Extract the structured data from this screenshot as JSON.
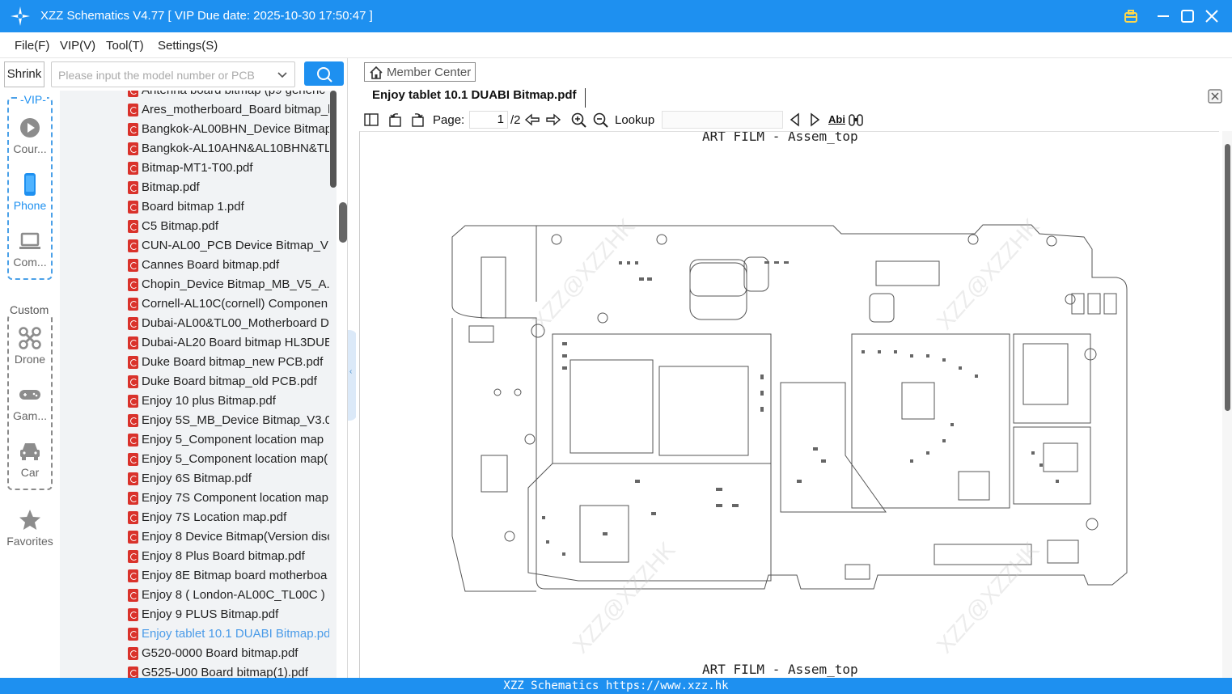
{
  "window": {
    "title": "XZZ Schematics V4.77 [ VIP Due date: 2025-10-30 17:50:47 ]",
    "accent": "#1e90f0"
  },
  "menu": [
    "File(F)",
    "VIP(V)",
    "Tool(T)",
    "Settings(S)"
  ],
  "left": {
    "shrink_label": "Shrink",
    "search_placeholder": "Please input the model number or PCB",
    "vip_label": "-VIP-",
    "custom_label": "Custom",
    "categories": [
      {
        "label": "Cour...",
        "icon": "play-icon"
      },
      {
        "label": "Phone",
        "icon": "phone-icon",
        "active": true
      },
      {
        "label": "Com...",
        "icon": "laptop-icon"
      },
      {
        "label": "Drone",
        "icon": "drone-icon"
      },
      {
        "label": "Gam...",
        "icon": "gamepad-icon"
      },
      {
        "label": "Car",
        "icon": "car-icon"
      },
      {
        "label": "Favorites",
        "icon": "star-icon"
      }
    ],
    "files": [
      "Antenna board bitmap (p9 generic",
      "Ares_motherboard_Board bitmap_l",
      "Bangkok-AL00BHN_Device Bitmap",
      "Bangkok-AL10AHN&AL10BHN&TL",
      "Bitmap-MT1-T00.pdf",
      "Bitmap.pdf",
      "Board bitmap 1.pdf",
      "C5 Bitmap.pdf",
      "CUN-AL00_PCB Device Bitmap_V1.(",
      "Cannes Board bitmap.pdf",
      "Chopin_Device Bitmap_MB_V5_A.p",
      "Cornell-AL10C(cornell) Componen",
      "Dubai-AL00&TL00_Motherboard D",
      "Dubai-AL20 Board bitmap HL3DUE",
      "Duke Board bitmap_new PCB.pdf",
      "Duke Board bitmap_old PCB.pdf",
      "Enjoy 10 plus Bitmap.pdf",
      "Enjoy 5S_MB_Device Bitmap_V3.01",
      "Enjoy 5_Component location map",
      "Enjoy 5_Component location map(",
      "Enjoy 6S Bitmap.pdf",
      "Enjoy 7S Component location map",
      "Enjoy 7S Location map.pdf",
      "Enjoy 8 Device Bitmap(Version disc",
      "Enjoy 8 Plus Board bitmap.pdf",
      "Enjoy 8E Bitmap board motherboa",
      "Enjoy 8 ( London-AL00C_TL00C ) (",
      "Enjoy 9 PLUS Bitmap.pdf",
      "Enjoy tablet 10.1 DUABI Bitmap.pd",
      "G520-0000 Board bitmap.pdf",
      "G525-U00 Board bitmap(1).pdf"
    ],
    "selected_index": 28
  },
  "right": {
    "member_center": "Member Center",
    "doc_tab": "Enjoy tablet 10.1 DUABI Bitmap.pdf",
    "page_label": "Page:",
    "page_current": "1",
    "page_total": "/2",
    "lookup_label": "Lookup",
    "lookup_value": "",
    "abc_label": "Abi",
    "doc_title_top": "ART FILM - Assem_top",
    "doc_title_bottom": "ART FILM - Assem_top",
    "watermark": "XZZ@XZZHK"
  },
  "status": "XZZ Schematics https://www.xzz.hk"
}
